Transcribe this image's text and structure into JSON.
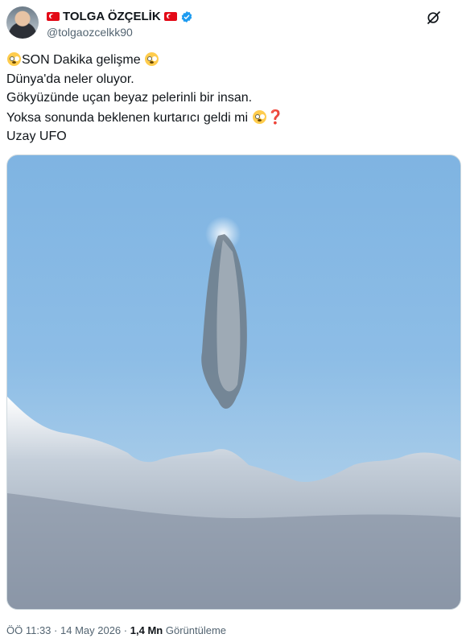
{
  "author": {
    "display_name": "TOLGA ÖZÇELİK",
    "handle": "@tolgaozcelkk90",
    "flag_icon": "turkey-flag-icon",
    "verified_icon": "verified-badge-icon"
  },
  "tweet": {
    "lines": [
      "SON Dakika gelişme",
      "Dünya'da neler oluyor.",
      "Gökyüzünde uçan beyaz pelerinli bir insan.",
      "Yoksa sonunda beklenen kurtarıcı geldi mi",
      "Uzay UFO"
    ],
    "emoji": "flushed-face-emoji",
    "question_mark": "❓"
  },
  "meta": {
    "time": "ÖÖ 11:33",
    "date": "14 May 2026",
    "separator": "·",
    "views_count": "1,4 Mn",
    "views_label": "Görüntüleme"
  },
  "colors": {
    "verified_blue": "#1d9bf0",
    "flag_red": "#e30a17",
    "muted": "#536471"
  }
}
